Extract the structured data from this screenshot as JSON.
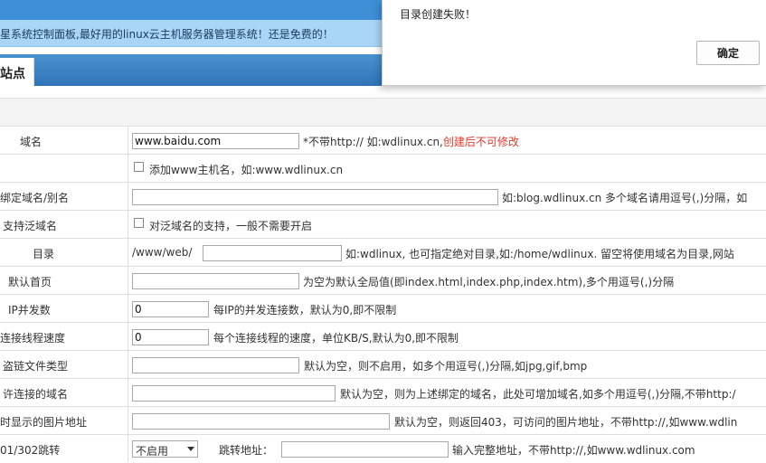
{
  "notice": "星系统控制面板,最好用的linux云主机服务器管理系统！还是免费的！",
  "nav": {
    "active_tab": "站点"
  },
  "dialog": {
    "message": "目录创建失败！",
    "ok_label": "确定"
  },
  "form": {
    "domain": {
      "label": "域名",
      "value": "www.baidu.com",
      "hint_prefix": "*不带http:// 如:wdlinux.cn,",
      "hint_warning": "创建后不可修改"
    },
    "add_www": {
      "label": "添加www主机名，如:www.wdlinux.cn",
      "checked": false
    },
    "alias": {
      "label": "绑定域名/别名",
      "value": "",
      "hint": "如:blog.wdlinux.cn 多个域名请用逗号(,)分隔，如"
    },
    "wildcard": {
      "label": "支持泛域名",
      "checkbox_label": "对泛域名的支持，一般不需要开启",
      "checked": false
    },
    "directory": {
      "label": "目录",
      "prefix": "/www/web/",
      "value": "",
      "hint": "如:wdlinux, 也可指定绝对目录,如:/home/wdlinux. 留空将使用域名为目录,网站"
    },
    "index": {
      "label": "默认首页",
      "value": "",
      "hint": "为空为默认全局值(即index.html,index.php,index.htm),多个用逗号(,)分隔"
    },
    "ip_conn": {
      "label": "IP并发数",
      "value": "0",
      "hint": "每IP的并发连接数，默认为0,即不限制"
    },
    "conn_speed": {
      "label": "连接线程速度",
      "value": "0",
      "hint": "每个连接线程的速度，单位KB/S,默认为0,即不限制"
    },
    "hotlink_types": {
      "label": "盗链文件类型",
      "value": "",
      "hint": "默认为空，则不启用，如多个用逗号(,)分隔,如jpg,gif,bmp"
    },
    "allowed_domains": {
      "label": "许连接的域名",
      "value": "",
      "hint": "默认为空，则为上述绑定的域名，此处可增加域名,如多个用逗号(,)分隔,不带http:/"
    },
    "hotlink_image": {
      "label": "时显示的图片地址",
      "value": "",
      "hint": "默认为空，则返回403，可访问的图片地址，不带http://,如www.wdlin"
    },
    "redirect": {
      "label": "01/302跳转",
      "select_value": "不启用",
      "addr_label": "跳转地址：",
      "value": "",
      "hint": "输入完整地址，不带http://,如www.wdlinux.com"
    }
  }
}
